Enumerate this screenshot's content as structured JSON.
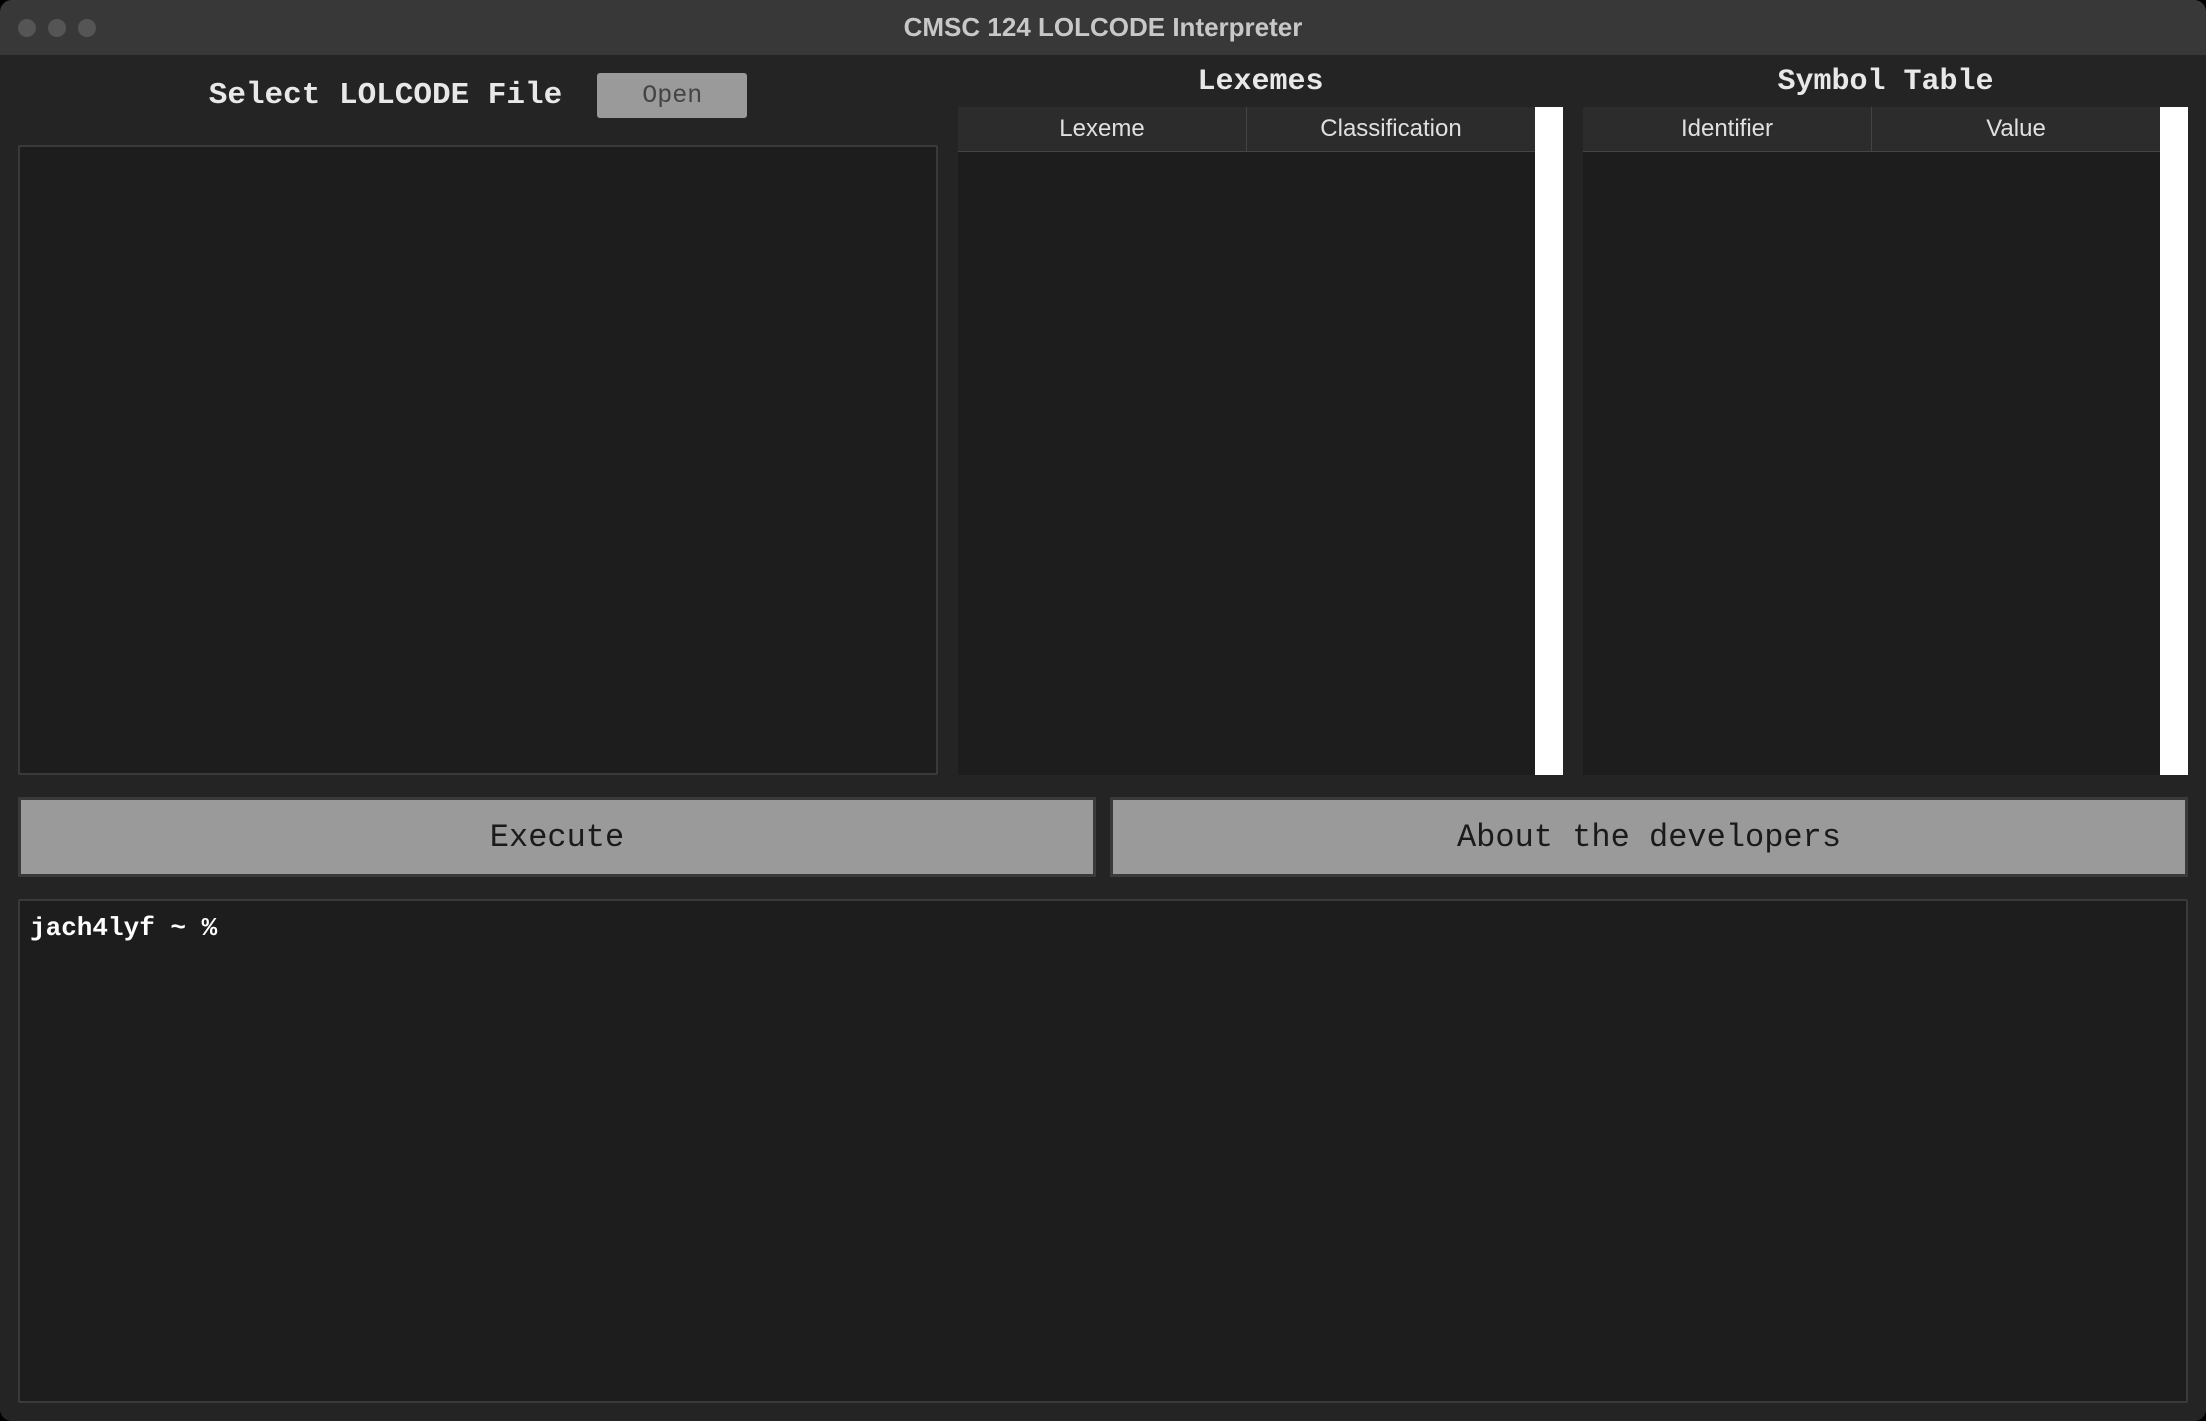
{
  "window": {
    "title": "CMSC 124 LOLCODE Interpreter"
  },
  "file_selector": {
    "label": "Select LOLCODE File",
    "open_button": "Open"
  },
  "lexemes_panel": {
    "title": "Lexemes",
    "columns": {
      "lexeme": "Lexeme",
      "classification": "Classification"
    }
  },
  "symbol_table_panel": {
    "title": "Symbol Table",
    "columns": {
      "identifier": "Identifier",
      "value": "Value"
    }
  },
  "buttons": {
    "execute": "Execute",
    "about": "About the developers"
  },
  "console": {
    "prompt": "jach4lyf ~ %"
  }
}
